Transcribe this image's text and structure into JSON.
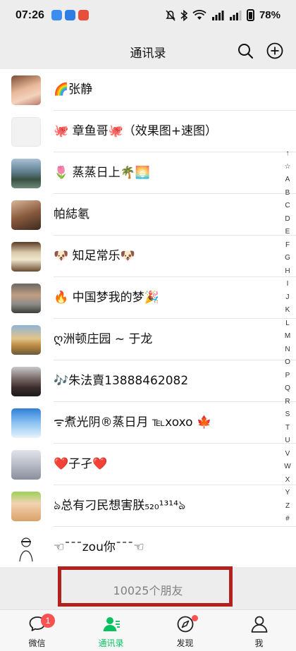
{
  "status_bar": {
    "time": "07:26",
    "battery": "78%"
  },
  "nav": {
    "title": "通讯录"
  },
  "contacts": [
    {
      "name": "🌈张静"
    },
    {
      "name": "🐙 章鱼哥🐙（效果图+速图）"
    },
    {
      "name": "🌷 蒸蒸日上🌴🌅"
    },
    {
      "name": "帕綕氡"
    },
    {
      "name": "🐶 知足常乐🐶"
    },
    {
      "name": "🔥 中国梦我的梦🎉"
    },
    {
      "name": "ღ洲顿庄园 ~ 于龙"
    },
    {
      "name": "🎶朱法賣13888462082"
    },
    {
      "name": "ᯤ煮光阴®蒸日月 ℡xoxo 🍁"
    },
    {
      "name": "❤️子孑❤️"
    },
    {
      "name": "ঌ总有刁民想害朕₅₂₀¹³¹⁴ঌ"
    },
    {
      "name": "☜ˉˉˉzou你ˉˉˉ☜"
    }
  ],
  "index_letters": [
    "↑",
    "☆",
    "A",
    "B",
    "C",
    "D",
    "E",
    "F",
    "G",
    "H",
    "I",
    "J",
    "K",
    "L",
    "M",
    "N",
    "O",
    "P",
    "Q",
    "R",
    "S",
    "T",
    "U",
    "V",
    "W",
    "X",
    "Y",
    "Z",
    "#"
  ],
  "footer": {
    "friend_count": "10025个朋友"
  },
  "tabs": [
    {
      "label": "微信",
      "badge": "1"
    },
    {
      "label": "通讯录"
    },
    {
      "label": "发现"
    },
    {
      "label": "我"
    }
  ],
  "colors": {
    "accent": "#07c160",
    "badge": "#fa5151",
    "highlight_box": "#b3211e"
  }
}
